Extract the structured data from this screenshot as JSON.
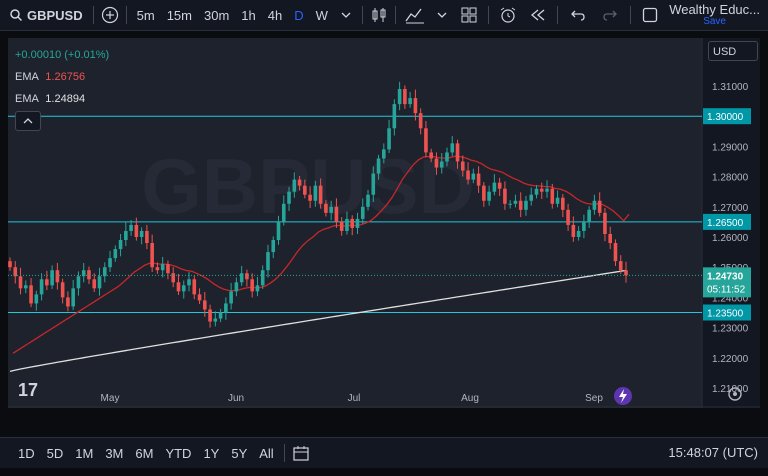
{
  "toolbar": {
    "symbol": "GBPUSD",
    "timeframes": [
      "5m",
      "15m",
      "30m",
      "1h",
      "4h",
      "D",
      "W"
    ],
    "active_timeframe": "D",
    "account_name": "Wealthy Educ...",
    "account_save": "Save"
  },
  "legend": {
    "change": "+0.00010 (+0.01%)",
    "ema1_label": "EMA",
    "ema1_value": "1.26756",
    "ema2_label": "EMA",
    "ema2_value": "1.24894"
  },
  "currency_select": "USD",
  "colors": {
    "up": "#26a69a",
    "down": "#ef5350",
    "ema_fast": "#c62828",
    "ema_slow": "#e0e0e0",
    "hline": "#26c6da",
    "accent": "#2962ff"
  },
  "chart_data": {
    "type": "candlestick",
    "symbol": "GBPUSD",
    "interval": "D",
    "ylim": [
      1.2,
      1.317
    ],
    "y_ticks": [
      "1.21000",
      "1.22000",
      "1.23000",
      "1.24000",
      "1.25000",
      "1.26000",
      "1.27000",
      "1.28000",
      "1.29000",
      "1.30000",
      "1.31000"
    ],
    "x_ticks": [
      "May",
      "Jun",
      "Jul",
      "Aug",
      "Sep"
    ],
    "horizontal_lines": [
      {
        "value": 1.3,
        "label": "1.30000"
      },
      {
        "value": 1.265,
        "label": "1.26500"
      },
      {
        "value": 1.235,
        "label": "1.23500"
      }
    ],
    "last_price": {
      "value": 1.2473,
      "label": "1.24730",
      "countdown": "05:11:52"
    },
    "closes": [
      1.25,
      1.247,
      1.243,
      1.244,
      1.238,
      1.241,
      1.246,
      1.244,
      1.249,
      1.245,
      1.24,
      1.237,
      1.243,
      1.247,
      1.249,
      1.246,
      1.243,
      1.247,
      1.25,
      1.253,
      1.256,
      1.259,
      1.262,
      1.264,
      1.26,
      1.262,
      1.258,
      1.25,
      1.249,
      1.251,
      1.248,
      1.245,
      1.242,
      1.244,
      1.246,
      1.241,
      1.239,
      1.236,
      1.232,
      1.233,
      1.235,
      1.238,
      1.242,
      1.245,
      1.248,
      1.246,
      1.242,
      1.244,
      1.249,
      1.255,
      1.259,
      1.265,
      1.271,
      1.275,
      1.279,
      1.277,
      1.274,
      1.272,
      1.277,
      1.271,
      1.268,
      1.27,
      1.265,
      1.262,
      1.266,
      1.263,
      1.266,
      1.27,
      1.274,
      1.281,
      1.286,
      1.289,
      1.296,
      1.304,
      1.309,
      1.304,
      1.306,
      1.301,
      1.296,
      1.288,
      1.286,
      1.283,
      1.285,
      1.288,
      1.291,
      1.285,
      1.282,
      1.279,
      1.281,
      1.277,
      1.272,
      1.275,
      1.278,
      1.276,
      1.271,
      1.271,
      1.272,
      1.269,
      1.272,
      1.274,
      1.276,
      1.275,
      1.276,
      1.271,
      1.273,
      1.269,
      1.264,
      1.26,
      1.262,
      1.265,
      1.269,
      1.272,
      1.268,
      1.261,
      1.258,
      1.252,
      1.249,
      1.2473
    ],
    "ema_fast_end": 1.26756,
    "ema_slow_end": 1.24894,
    "watermark": "GBPUSD",
    "countdown_text": "05:11:52"
  },
  "bottom": {
    "ranges": [
      "1D",
      "5D",
      "1M",
      "3M",
      "6M",
      "YTD",
      "1Y",
      "5Y",
      "All"
    ],
    "time": "15:48:07 (UTC)"
  }
}
